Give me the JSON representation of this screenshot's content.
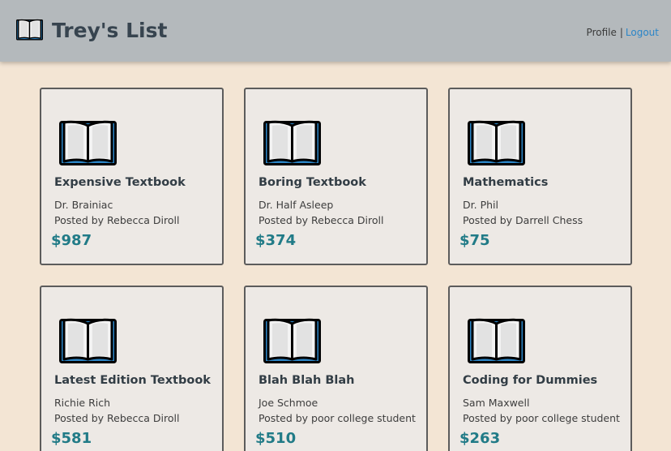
{
  "header": {
    "title": "Trey's List",
    "logo_icon": "book-icon",
    "nav": {
      "profile": "Profile",
      "separator": "|",
      "logout": "Logout"
    }
  },
  "colors": {
    "header_bg": "#b4b9bc",
    "page_bg": "#f3e5d4",
    "card_bg": "#ede9e5",
    "price": "#217b87",
    "link": "#2a85c8"
  },
  "listings": [
    {
      "title": "Expensive Textbook",
      "author": "Dr. Brainiac",
      "posted_by": "Posted by Rebecca Diroll",
      "price": "$987",
      "icon": "book-icon"
    },
    {
      "title": "Boring Textbook",
      "author": "Dr. Half Asleep",
      "posted_by": "Posted by Rebecca Diroll",
      "price": "$374",
      "icon": "book-icon"
    },
    {
      "title": "Mathematics",
      "author": "Dr. Phil",
      "posted_by": "Posted by Darrell Chess",
      "price": "$75",
      "icon": "book-icon"
    },
    {
      "title": "Latest Edition Textbook",
      "author": "Richie Rich",
      "posted_by": "Posted by Rebecca Diroll",
      "price": "$581",
      "icon": "book-icon"
    },
    {
      "title": "Blah Blah Blah",
      "author": "Joe Schmoe",
      "posted_by": "Posted by poor college student",
      "price": "$510",
      "icon": "book-icon"
    },
    {
      "title": "Coding for Dummies",
      "author": "Sam Maxwell",
      "posted_by": "Posted by poor college student",
      "price": "$263",
      "icon": "book-icon"
    }
  ]
}
